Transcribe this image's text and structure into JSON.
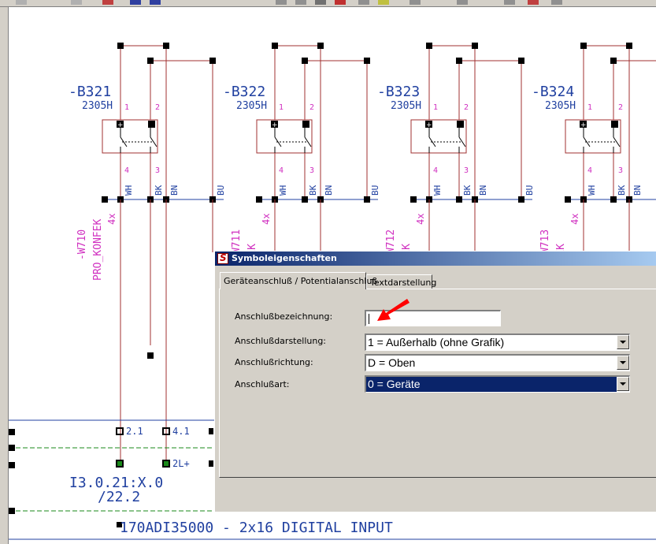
{
  "devices": [
    {
      "tag": "-B321",
      "type": "2305H",
      "cable": "-W710",
      "cable_type": "PRO_KONFEK",
      "cores": "4x"
    },
    {
      "tag": "-B322",
      "type": "2305H",
      "cable": "-W711",
      "cable_type": "KONFEK",
      "cores": "4x"
    },
    {
      "tag": "-B323",
      "type": "2305H",
      "cable": "-W712",
      "cable_type": "KONFEK",
      "cores": "4x"
    },
    {
      "tag": "-B324",
      "type": "2305H",
      "cable": "-W713",
      "cable_type": "KONFEK",
      "cores": "4x"
    }
  ],
  "pins": {
    "top_left": "1",
    "top_right": "2",
    "bottom_left": "4",
    "bottom_right": "3"
  },
  "wire_colors": [
    "WH",
    "BK",
    "BN",
    "BU"
  ],
  "terminals": {
    "t1": "2.1",
    "t2": "4.1",
    "t3": "2L+"
  },
  "io_address": "I3.0.21:X.0",
  "io_address_sub": "/22.2",
  "module_title": "170ADI35000 - 2x16 DIGITAL INPUT",
  "dialog": {
    "title": "Symboleigenschaften",
    "tabs": [
      "Geräteanschluß / Potentialanschluß",
      "Textdarstellung"
    ],
    "fields": {
      "bezeichnung_label": "Anschlußbezeichnung:",
      "bezeichnung_value": "",
      "darstellung_label": "Anschlußdarstellung:",
      "darstellung_value": "1 = Außerhalb (ohne Grafik)",
      "richtung_label": "Anschlußrichtung:",
      "richtung_value": "D = Oben",
      "art_label": "Anschlußart:",
      "art_value": "0 = Geräte"
    }
  },
  "colors": {
    "wire": "#a03030",
    "text_blue": "#2040a0",
    "text_magenta": "#d030c0",
    "dialog_bg": "#d4d0c8",
    "title_bar": "#0a246a",
    "annotation": "#ff0000"
  }
}
